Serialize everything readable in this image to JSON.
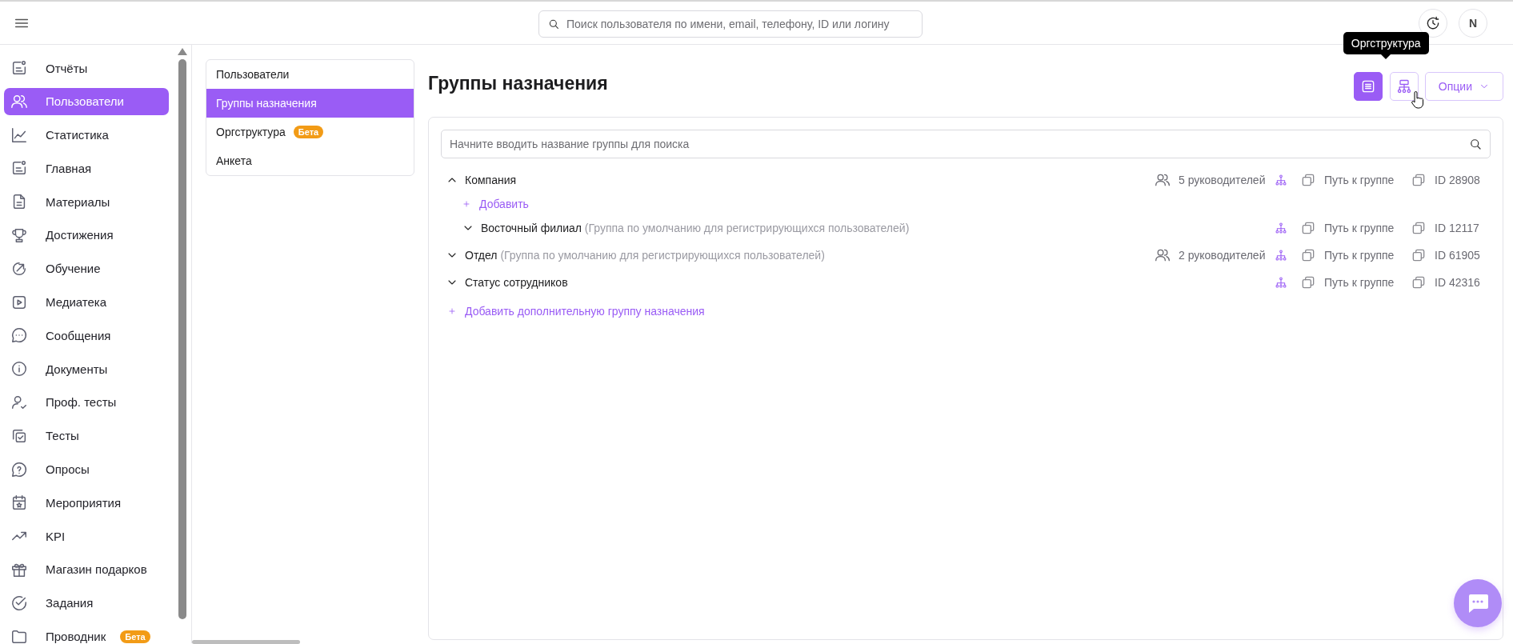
{
  "search": {
    "placeholder": "Поиск пользователя по имени, email, телефону, ID или логину"
  },
  "avatar": {
    "initial": "N"
  },
  "sidebar": {
    "items": [
      {
        "label": "Отчёты",
        "selected": false
      },
      {
        "label": "Пользователи",
        "selected": true
      },
      {
        "label": "Статистика",
        "selected": false
      },
      {
        "label": "Главная",
        "selected": false
      },
      {
        "label": "Материалы",
        "selected": false
      },
      {
        "label": "Достижения",
        "selected": false
      },
      {
        "label": "Обучение",
        "selected": false
      },
      {
        "label": "Медиатека",
        "selected": false
      },
      {
        "label": "Сообщения",
        "selected": false
      },
      {
        "label": "Документы",
        "selected": false
      },
      {
        "label": "Проф. тесты",
        "selected": false
      },
      {
        "label": "Тесты",
        "selected": false
      },
      {
        "label": "Опросы",
        "selected": false
      },
      {
        "label": "Мероприятия",
        "selected": false
      },
      {
        "label": "KPI",
        "selected": false
      },
      {
        "label": "Магазин подарков",
        "selected": false
      },
      {
        "label": "Задания",
        "selected": false
      },
      {
        "label": "Проводник",
        "selected": false,
        "badge": "Бета"
      }
    ]
  },
  "subnav": {
    "items": [
      {
        "label": "Пользователи",
        "selected": false
      },
      {
        "label": "Группы назначения",
        "selected": true
      },
      {
        "label": "Оргструктура",
        "selected": false,
        "badge": "Бета"
      },
      {
        "label": "Анкета",
        "selected": false
      }
    ]
  },
  "title": "Группы назначения",
  "toolbar": {
    "list_view_selected": true,
    "org_view_selected": false,
    "tooltip": "Оргструктура",
    "options": "Опции"
  },
  "group_search": {
    "placeholder": "Начните вводить название группы для поиска"
  },
  "groups": [
    {
      "name": "Компания",
      "expanded": true,
      "managers": "5 руководителей",
      "path": "Путь к группе",
      "id": "ID 28908",
      "add_label": "Добавить",
      "children": [
        {
          "name": "Восточный филиал",
          "note": "(Группа по умолчанию для регистрирующихся пользователей)",
          "expanded": false,
          "path": "Путь к группе",
          "id": "ID 12117"
        }
      ]
    },
    {
      "name": "Отдел",
      "note": "(Группа по умолчанию для регистрирующихся пользователей)",
      "expanded": false,
      "managers": "2 руководителей",
      "path": "Путь к группе",
      "id": "ID 61905"
    },
    {
      "name": "Статус сотрудников",
      "expanded": false,
      "path": "Путь к группе",
      "id": "ID 42316"
    }
  ],
  "add_group": "Добавить дополнительную группу назначения"
}
